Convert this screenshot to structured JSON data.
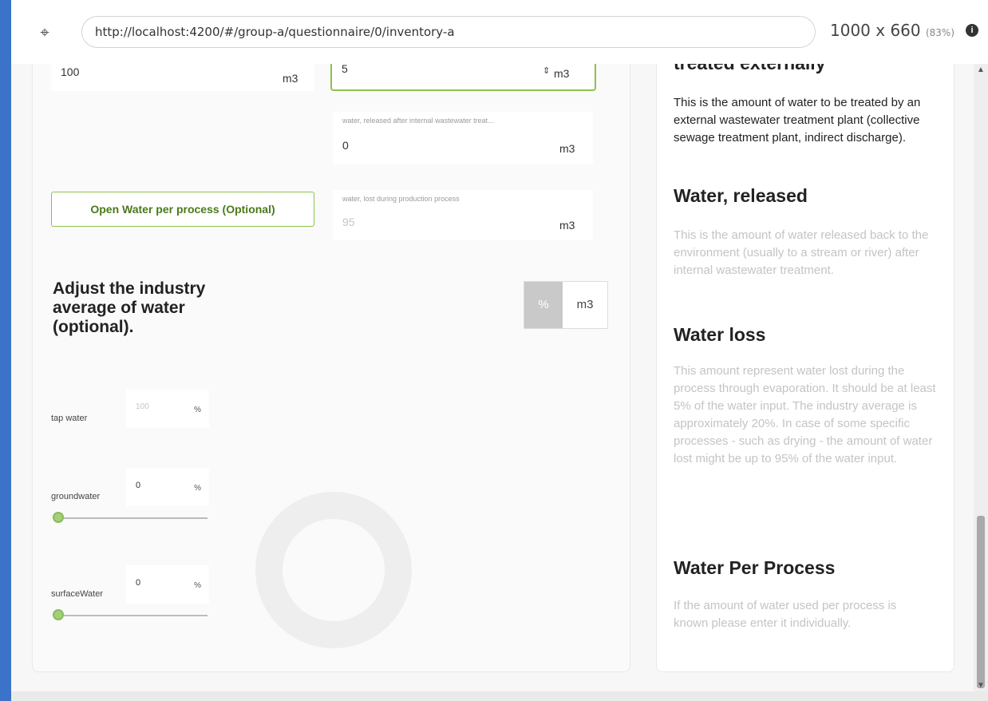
{
  "browser": {
    "url": "http://localhost:4200/#/group-a/questionnaire/0/inventory-a",
    "dimensions": "1000 x 660",
    "zoom": "(83%)"
  },
  "form": {
    "field_left_value": "100",
    "field_left_unit": "m3",
    "field_5_value": "5",
    "field_5_unit": "m3",
    "released": {
      "label": "water, released after internal wastewater treat...",
      "value": "0",
      "unit": "m3"
    },
    "lost": {
      "label": "water, lost during production process",
      "value": "95",
      "unit": "m3"
    },
    "open_button": "Open Water per process (Optional)",
    "adjust_title": "Adjust the industry average of water (optional).",
    "toggle": {
      "percent": "%",
      "m3": "m3",
      "selected": "%"
    },
    "sources": [
      {
        "label": "tap water",
        "value": "100",
        "unit": "%"
      },
      {
        "label": "groundwater",
        "value": "0",
        "unit": "%",
        "slider": 0
      },
      {
        "label": "surfaceWater",
        "value": "0",
        "unit": "%",
        "slider": 0
      }
    ]
  },
  "help": {
    "section1_heading": "treated externally",
    "section1_text": "This is the amount of water to be treated by an external wastewater treatment plant (collective sewage treatment plant, indirect discharge).",
    "section2_heading": "Water, released",
    "section2_text": "This is the amount of water released back to the environment (usually to a stream or river) after internal wastewater treatment.",
    "section3_heading": "Water loss",
    "section3_text": "This amount represent water lost during the process through evaporation. It should be at least 5% of the water input. The industry average is approximately 20%. In case of some specific processes - such as drying - the amount of water lost might be up to 95% of the water input.",
    "section4_heading": "Water Per Process",
    "section4_text": "If the amount of water used per process is known please enter it individually."
  },
  "colors": {
    "accent": "#8bc34a",
    "button_text": "#4a7a1a",
    "toggle_selected": "#c9c9c9"
  }
}
